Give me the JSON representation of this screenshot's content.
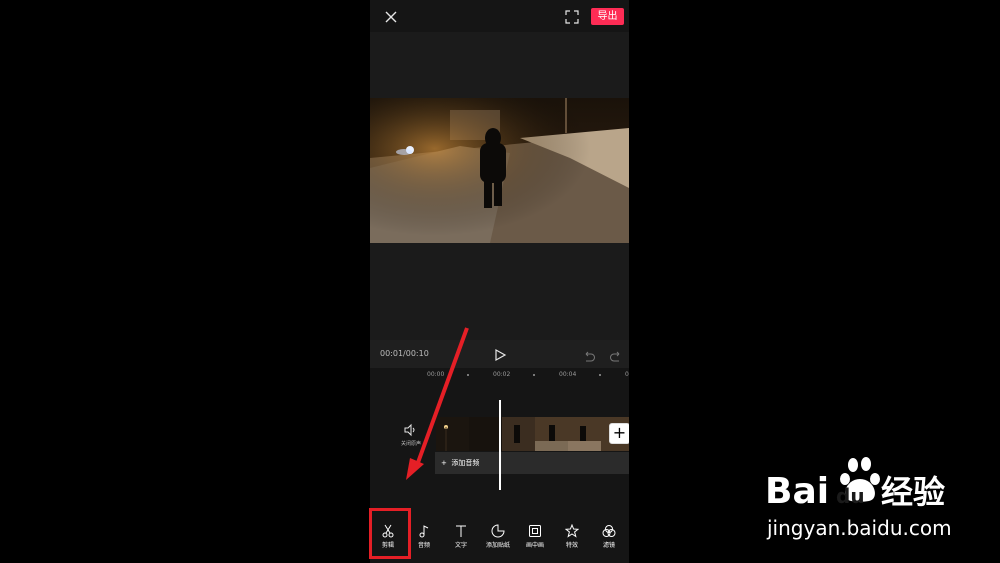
{
  "header": {
    "export_label": "导出"
  },
  "player": {
    "timecode": "00:01/00:10"
  },
  "timeline": {
    "ruler_ticks": [
      "00:00",
      "00:02",
      "00:04",
      "0"
    ],
    "mute_label": "关闭原声",
    "add_audio_label": "添加音频"
  },
  "toolbar": {
    "items": [
      {
        "label": "剪辑",
        "icon": "scissors-icon"
      },
      {
        "label": "音频",
        "icon": "music-note-icon"
      },
      {
        "label": "文字",
        "icon": "text-icon"
      },
      {
        "label": "添加贴纸",
        "icon": "sticker-icon"
      },
      {
        "label": "画中画",
        "icon": "picture-in-picture-icon"
      },
      {
        "label": "特效",
        "icon": "effects-star-icon"
      },
      {
        "label": "滤镜",
        "icon": "filter-icon"
      }
    ]
  },
  "watermark": {
    "brand_text": "Bai du 经验",
    "url_text": "jingyan.baidu.com"
  },
  "colors": {
    "accent": "#fe2c55",
    "highlight": "#e51f26"
  }
}
